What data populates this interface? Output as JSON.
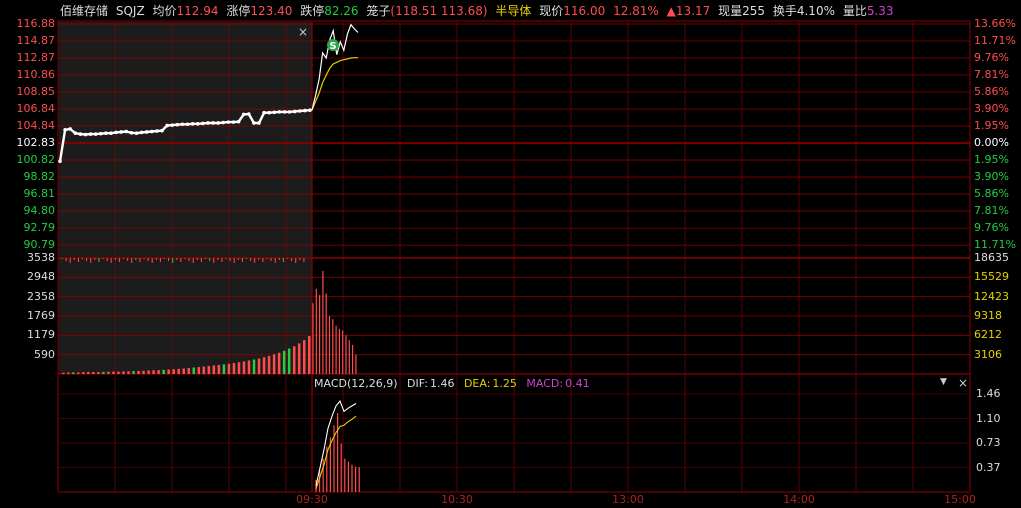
{
  "header": {
    "name": "佰维存储",
    "code": "SQJZ",
    "avg_label": "均价",
    "avg_value": "112.94",
    "limit_up_label": "涨停",
    "limit_up_value": "123.40",
    "limit_down_label": "跌停",
    "limit_down_value": "82.26",
    "cage_label": "笼子",
    "cage_value": "(118.51 113.68)",
    "sector": "半导体",
    "price_label": "现价",
    "price_value": "116.00",
    "pct_change": "12.81%",
    "change_arrow": "▲",
    "change_value": "13.17",
    "vol_label": "现量",
    "vol_value": "255",
    "turnover_label": "换手",
    "turnover_value": "4.10%",
    "ratio_label": "量比",
    "ratio_value": "5.33"
  },
  "colors": {
    "up": "#ff4d4d",
    "down": "#22cc44",
    "grid": "#8b0000",
    "price_line": "#ffffff",
    "avg_line": "#e6d000",
    "macd_label": "#cc44cc",
    "dea_label": "#e6d000",
    "sector": "#e6d000",
    "ratio": "#cc44cc",
    "axis_neutral": "#ffffff"
  },
  "price_axis_left": [
    "116.88",
    "114.87",
    "112.87",
    "110.86",
    "108.85",
    "106.84",
    "104.84",
    "102.83",
    "100.82",
    "98.82",
    "96.81",
    "94.80",
    "92.79",
    "90.79"
  ],
  "price_axis_right": [
    "13.66%",
    "11.71%",
    "9.76%",
    "7.81%",
    "5.86%",
    "3.90%",
    "1.95%",
    "0.00%",
    "1.95%",
    "3.90%",
    "5.86%",
    "7.81%",
    "9.76%",
    "11.71%"
  ],
  "volume_axis_left": [
    "3538",
    "2948",
    "2358",
    "1769",
    "1179",
    "590"
  ],
  "volume_axis_right": [
    "18635",
    "15529",
    "12423",
    "9318",
    "6212",
    "3106"
  ],
  "macd": {
    "title": "MACD(12,26,9)",
    "dif_label": "DIF:",
    "dif_value": "1.46",
    "dea_label": "DEA:",
    "dea_value": "1.25",
    "macd_label": "MACD:",
    "macd_value": "0.41",
    "axis": [
      "1.46",
      "1.10",
      "0.73",
      "0.37"
    ]
  },
  "time_labels": [
    "09:30",
    "10:30",
    "13:00",
    "14:00",
    "15:00"
  ],
  "signal_marker": "S",
  "close_symbol": "×",
  "dropdown_symbol": "▼",
  "chart_data": {
    "type": "line",
    "prev_close": 102.83,
    "price_range": [
      90.79,
      116.88
    ],
    "preopen_price": [
      100.82,
      104.5,
      104.6,
      104.1,
      104.0,
      103.95,
      104.0,
      104.0,
      104.05,
      104.1,
      104.1,
      104.2,
      104.25,
      104.3,
      104.15,
      104.1,
      104.2,
      104.25,
      104.3,
      104.35,
      104.4,
      105.0,
      105.05,
      105.1,
      105.15,
      105.15,
      105.2,
      105.2,
      105.25,
      105.3,
      105.3,
      105.3,
      105.35,
      105.4,
      105.4,
      105.45,
      106.3,
      106.35,
      105.3,
      105.3,
      106.5,
      106.5,
      106.55,
      106.6,
      106.6,
      106.6,
      106.65,
      106.7,
      106.75,
      106.8
    ],
    "price": [
      106.8,
      108.5,
      110.4,
      113.5,
      112.9,
      115.0,
      116.1,
      113.3,
      114.8,
      113.8,
      115.7,
      116.8,
      116.3,
      115.9
    ],
    "avg_price": [
      106.8,
      107.8,
      108.8,
      110.0,
      110.9,
      111.7,
      112.2,
      112.4,
      112.6,
      112.7,
      112.8,
      112.9,
      112.94,
      112.94
    ],
    "volume_range": [
      0,
      3538
    ],
    "preopen_volume": [
      40,
      45,
      50,
      48,
      55,
      60,
      62,
      58,
      65,
      70,
      75,
      72,
      80,
      85,
      90,
      95,
      100,
      110,
      115,
      120,
      130,
      140,
      150,
      160,
      170,
      185,
      200,
      215,
      230,
      250,
      265,
      280,
      300,
      320,
      340,
      365,
      390,
      420,
      450,
      480,
      520,
      560,
      610,
      660,
      720,
      790,
      860,
      950,
      1050,
      1180
    ],
    "volume": [
      2200,
      2650,
      2450,
      3200,
      2500,
      1800,
      1700,
      1500,
      1400,
      1350,
      1200,
      1050,
      900,
      600
    ],
    "macd_range": [
      0,
      1.6
    ],
    "dif": [
      0.1,
      0.4,
      0.7,
      1.05,
      1.25,
      1.42,
      1.5,
      1.33,
      1.38,
      1.42,
      1.46
    ],
    "dea": [
      0.05,
      0.25,
      0.45,
      0.7,
      0.85,
      0.98,
      1.08,
      1.1,
      1.16,
      1.2,
      1.25
    ],
    "macd_bars": [
      0.2,
      0.35,
      0.55,
      0.75,
      0.9,
      1.1,
      1.3,
      0.8,
      0.55,
      0.5,
      0.45,
      0.42,
      0.41
    ]
  }
}
